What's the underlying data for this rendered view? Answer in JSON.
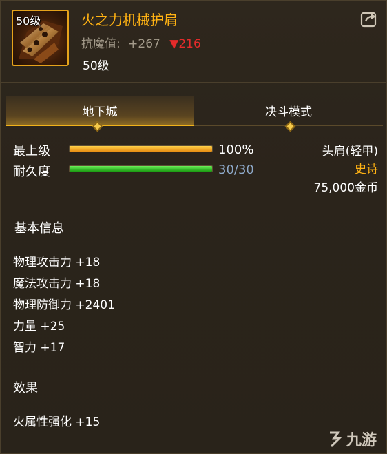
{
  "item": {
    "icon_level": "50级",
    "name": "火之力机械护肩",
    "resist_label": "抗魔值:",
    "resist_value": "+267",
    "resist_diff": "▼216",
    "level_text": "50级",
    "icon": "shoulder-armor-icon"
  },
  "tabs": [
    {
      "label": "地下城",
      "active": true
    },
    {
      "label": "决斗模式",
      "active": false
    }
  ],
  "stats": {
    "max_level": {
      "label": "最上级",
      "value": "100%",
      "fraction": 1.0
    },
    "durability": {
      "label": "耐久度",
      "value": "30/30",
      "fraction": 1.0
    }
  },
  "meta": {
    "slot": "头肩(轻甲)",
    "rarity": "史诗",
    "price": "75,000金币"
  },
  "basic_info": {
    "title": "基本信息",
    "lines": [
      "物理攻击力 +18",
      "魔法攻击力 +18",
      "物理防御力 +2401",
      "力量 +25",
      "智力 +17"
    ]
  },
  "effects": {
    "title": "效果",
    "lines": [
      "火属性强化 +15"
    ]
  },
  "brand": {
    "text": "九游"
  },
  "colors": {
    "name": "#ffb213",
    "rarity": "#ffb213",
    "resist_diff": "#e42b2b",
    "durability_value": "#8ea9c9",
    "tab_active": "#f0b21a"
  }
}
